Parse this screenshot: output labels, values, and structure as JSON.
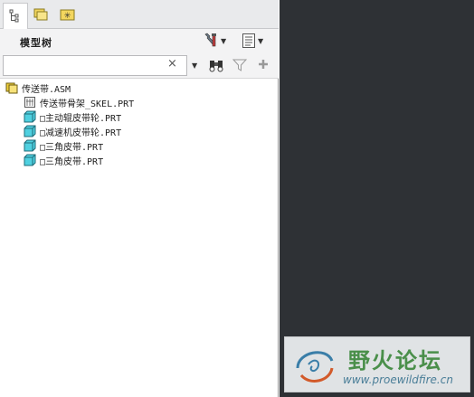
{
  "panel": {
    "tabs": [
      {
        "name": "model-tree-tab",
        "icon": "tree-icon"
      },
      {
        "name": "folder-browser-tab",
        "icon": "folders-icon"
      },
      {
        "name": "favorites-tab",
        "icon": "star-folder-icon"
      }
    ],
    "title": "模型树",
    "settings_icon": "settings-tools-icon",
    "show_icon": "show-list-icon",
    "search": {
      "value": "",
      "placeholder": ""
    },
    "find_icon": "binoculars-icon",
    "filter_icon": "filter-icon",
    "add_icon": "plus-icon"
  },
  "tree": {
    "root": {
      "label": "传送带.ASM",
      "icon": "assembly-icon"
    },
    "children": [
      {
        "label": "传送带骨架_SKEL.PRT",
        "icon": "skeleton-part-icon"
      },
      {
        "label": "□主动辊皮带轮.PRT",
        "icon": "part-icon"
      },
      {
        "label": "□减速机皮带轮.PRT",
        "icon": "part-icon"
      },
      {
        "label": "□三角皮带.PRT",
        "icon": "part-icon"
      },
      {
        "label": "□三角皮带.PRT",
        "icon": "part-icon"
      }
    ]
  },
  "watermark": {
    "title": "野火论坛",
    "url": "www.proewildfire.cn"
  },
  "colors": {
    "viewport_bg": "#2e3135",
    "part_color": "#4fd0e0",
    "assembly_color": "#f2d23c"
  }
}
